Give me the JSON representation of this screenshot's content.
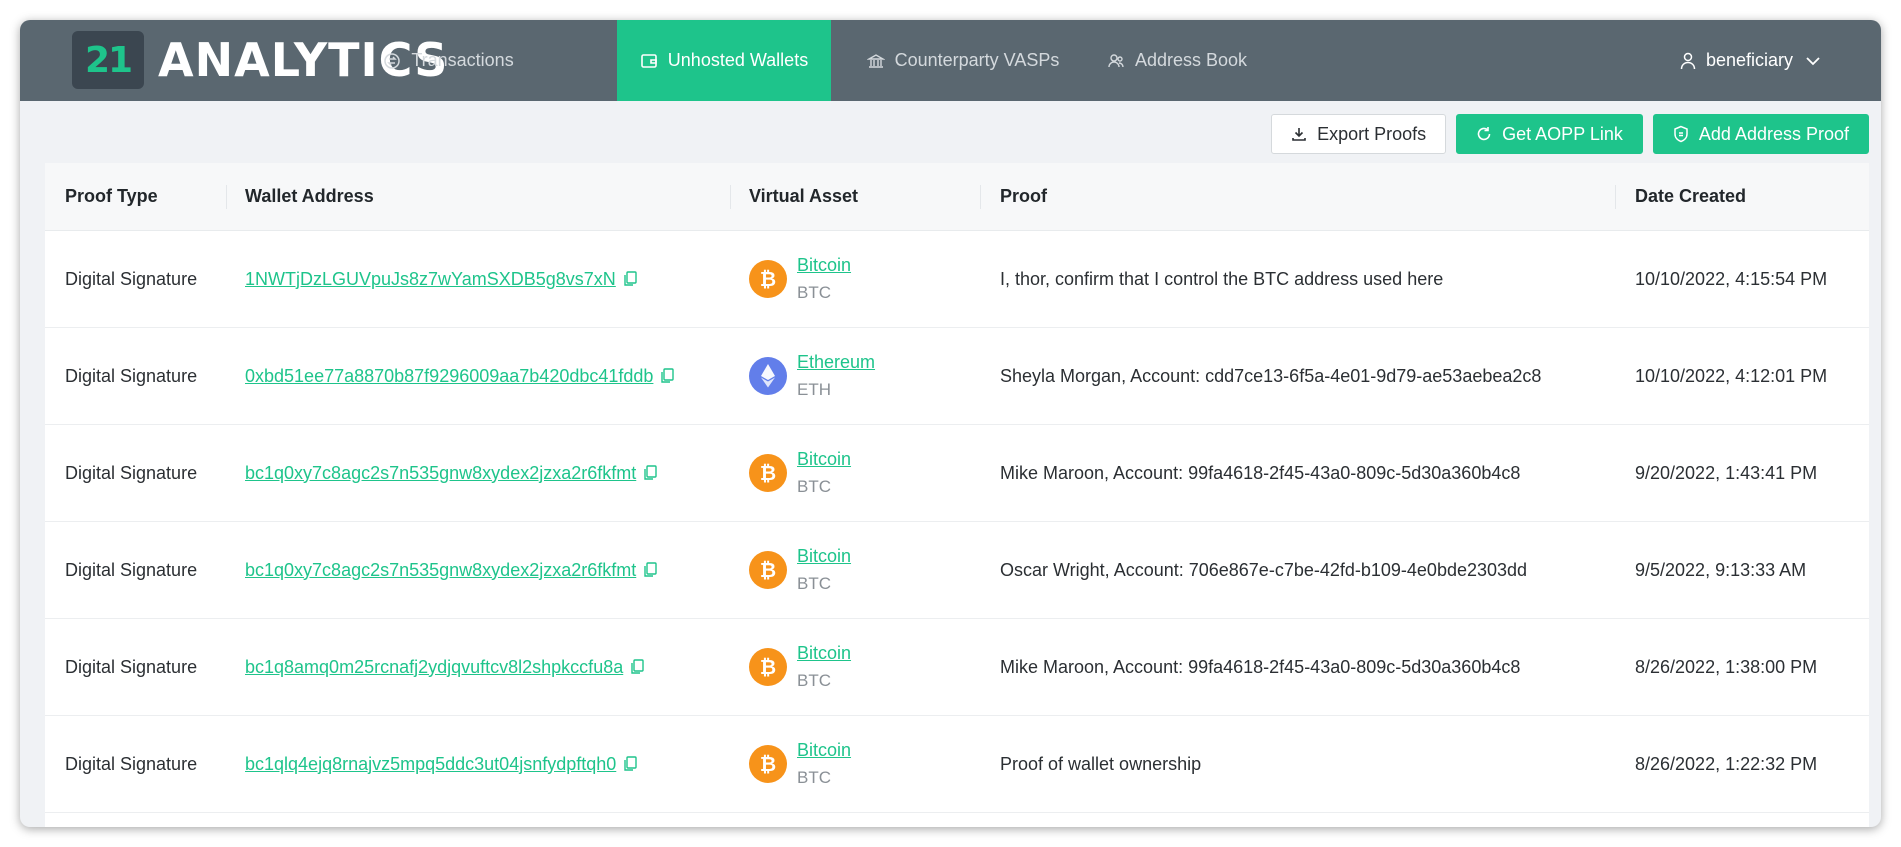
{
  "brand": {
    "logo_mark": "21",
    "logo_text": "ANALYTICS"
  },
  "nav": [
    {
      "label": "Transactions",
      "icon": "transactions-icon",
      "active": false
    },
    {
      "label": "Unhosted Wallets",
      "icon": "wallet-icon",
      "active": true
    },
    {
      "label": "Counterparty VASPs",
      "icon": "bank-icon",
      "active": false
    },
    {
      "label": "Address Book",
      "icon": "users-icon",
      "active": false
    }
  ],
  "user": {
    "name": "beneficiary"
  },
  "actions": {
    "export": "Export Proofs",
    "aopp": "Get AOPP Link",
    "add": "Add Address Proof"
  },
  "table": {
    "headers": [
      "Proof Type",
      "Wallet Address",
      "Virtual Asset",
      "Proof",
      "Date Created"
    ],
    "rows": [
      {
        "proof_type": "Digital Signature",
        "address": "1NWTjDzLGUVpuJs8z7wYamSXDB5g8vs7xN",
        "asset": "Bitcoin",
        "symbol": "BTC",
        "proof": "I, thor, confirm that I control the BTC address used here",
        "date": "10/10/2022, 4:15:54 PM"
      },
      {
        "proof_type": "Digital Signature",
        "address": "0xbd51ee77a8870b87f9296009aa7b420dbc41fddb",
        "asset": "Ethereum",
        "symbol": "ETH",
        "proof": "Sheyla Morgan, Account: cdd7ce13-6f5a-4e01-9d79-ae53aebea2c8",
        "date": "10/10/2022, 4:12:01 PM"
      },
      {
        "proof_type": "Digital Signature",
        "address": "bc1q0xy7c8agc2s7n535gnw8xydex2jzxa2r6fkfmt",
        "asset": "Bitcoin",
        "symbol": "BTC",
        "proof": "Mike Maroon, Account: 99fa4618-2f45-43a0-809c-5d30a360b4c8",
        "date": "9/20/2022, 1:43:41 PM"
      },
      {
        "proof_type": "Digital Signature",
        "address": "bc1q0xy7c8agc2s7n535gnw8xydex2jzxa2r6fkfmt",
        "asset": "Bitcoin",
        "symbol": "BTC",
        "proof": "Oscar Wright, Account: 706e867e-c7be-42fd-b109-4e0bde2303dd",
        "date": "9/5/2022, 9:13:33 AM"
      },
      {
        "proof_type": "Digital Signature",
        "address": "bc1q8amq0m25rcnafj2ydjqvuftcv8l2shpkccfu8a",
        "asset": "Bitcoin",
        "symbol": "BTC",
        "proof": "Mike Maroon, Account: 99fa4618-2f45-43a0-809c-5d30a360b4c8",
        "date": "8/26/2022, 1:38:00 PM"
      },
      {
        "proof_type": "Digital Signature",
        "address": "bc1qlq4ejq8rnajvz5mpq5ddc3ut04jsnfydpftqh0",
        "asset": "Bitcoin",
        "symbol": "BTC",
        "proof": "Proof of wallet ownership",
        "date": "8/26/2022, 1:22:32 PM"
      }
    ]
  },
  "colors": {
    "accent": "#1ec48b",
    "topbar": "#5a6770",
    "bitcoin": "#f7931a",
    "ethereum": "#627eea"
  }
}
